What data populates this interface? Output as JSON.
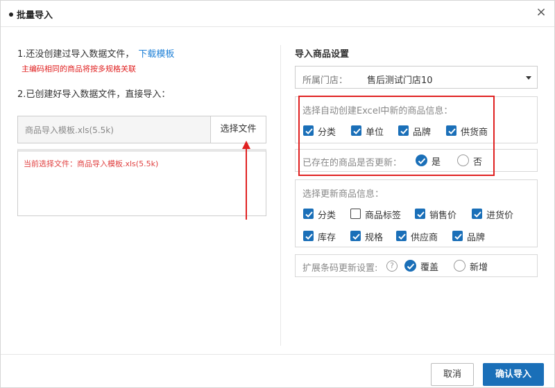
{
  "dialog": {
    "title": "批量导入",
    "close_glyph": "×"
  },
  "left": {
    "step1_text": "1.还没创建过导入数据文件，",
    "download_link": "下载模板",
    "warning": "主编码相同的商品将按多规格关联",
    "step2_text": "2.已创建好导入数据文件，直接导入：",
    "file_name": "商品导入模板.xls(5.5k)",
    "choose_button": "选择文件",
    "current_file": "当前选择文件：商品导入模板.xls(5.5k)"
  },
  "right": {
    "title": "导入商品设置",
    "store": {
      "label": "所属门店：",
      "value": "售后测试门店10"
    },
    "auto_create": {
      "label": "选择自动创建Excel中新的商品信息：",
      "options": [
        {
          "label": "分类",
          "checked": true
        },
        {
          "label": "单位",
          "checked": true
        },
        {
          "label": "品牌",
          "checked": true
        },
        {
          "label": "供货商",
          "checked": true
        }
      ]
    },
    "update_existing": {
      "label": "已存在的商品是否更新：",
      "options": [
        {
          "label": "是",
          "selected": true
        },
        {
          "label": "否",
          "selected": false
        }
      ]
    },
    "update_info": {
      "label": "选择更新商品信息：",
      "row1": [
        {
          "label": "分类",
          "checked": true
        },
        {
          "label": "商品标签",
          "checked": false
        },
        {
          "label": "销售价",
          "checked": true
        },
        {
          "label": "进货价",
          "checked": true
        }
      ],
      "row2": [
        {
          "label": "库存",
          "checked": true
        },
        {
          "label": "规格",
          "checked": true
        },
        {
          "label": "供应商",
          "checked": true
        },
        {
          "label": "品牌",
          "checked": true
        }
      ]
    },
    "barcode": {
      "label": "扩展条码更新设置:",
      "help": "?",
      "options": [
        {
          "label": "覆盖",
          "selected": true
        },
        {
          "label": "新增",
          "selected": false
        }
      ]
    }
  },
  "footer": {
    "cancel": "取消",
    "confirm": "确认导入"
  },
  "colors": {
    "accent": "#1a6fb8",
    "warning": "#e02020",
    "annotation": "#e02020"
  }
}
